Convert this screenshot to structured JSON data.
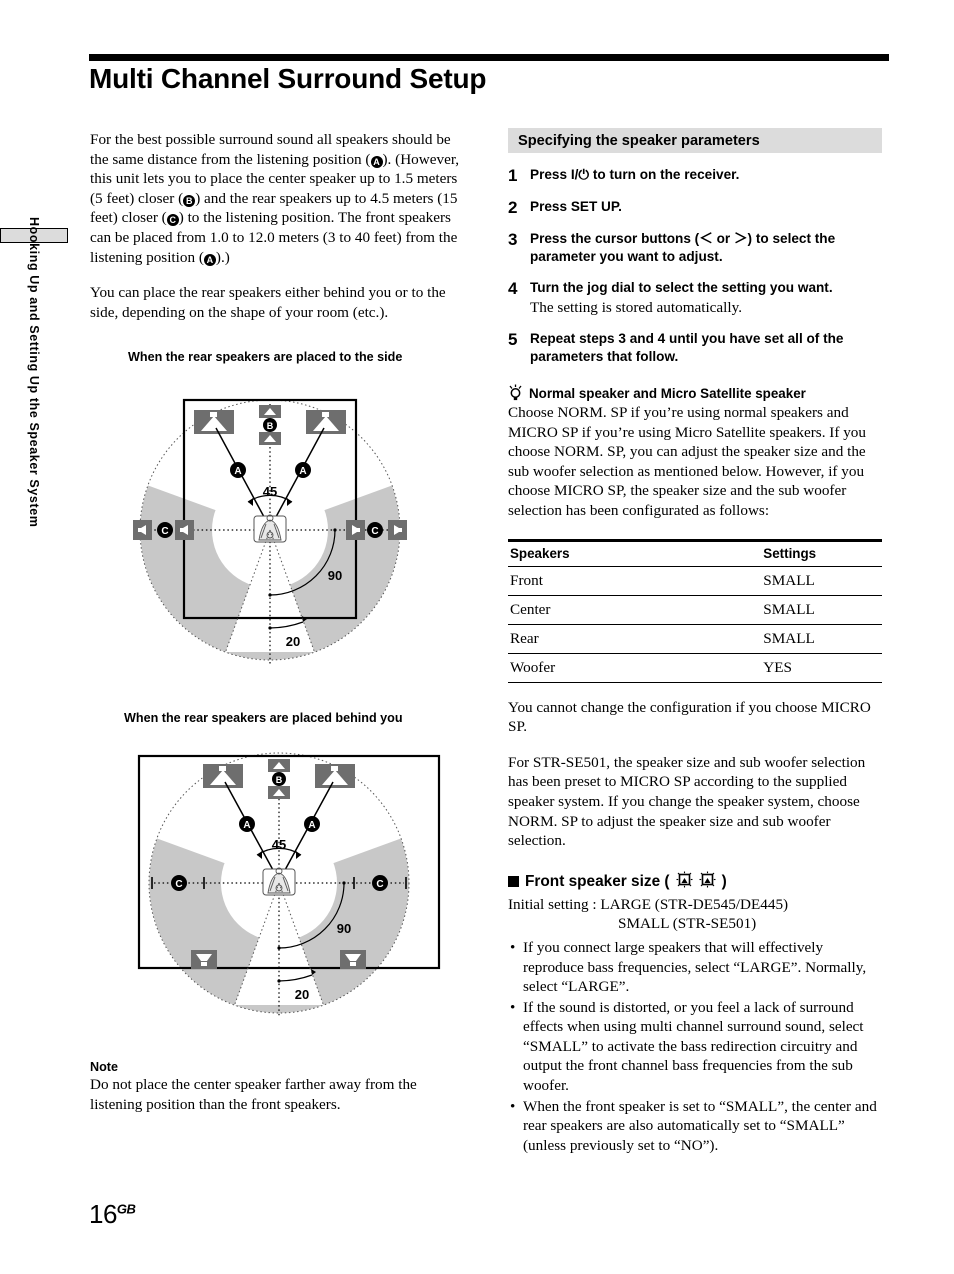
{
  "side_tab": {
    "label": "Hooking Up and Setting Up the Speaker System"
  },
  "title": "Multi Channel Surround Setup",
  "page_number": {
    "num": "16",
    "suffix": "GB"
  },
  "left": {
    "para1_a": "For the best possible surround sound all speakers should be the same distance from the listening position (",
    "mark_a1": "A",
    "para1_b": ").  (However, this unit lets you to place the center speaker up to 1.5 meters (5 feet) closer (",
    "mark_b": "B",
    "para1_c": ") and the rear speakers up to 4.5 meters (15 feet) closer (",
    "mark_c": "C",
    "para1_d": ") to the listening position. The front speakers can be placed from 1.0 to 12.0 meters (3 to 40 feet) from the listening position (",
    "mark_a2": "A",
    "para1_e": ").)",
    "para2": "You can place the rear speakers either behind you or to the side, depending on the shape of your room (etc.).",
    "diagram1_caption": "When the rear speakers are placed to the side",
    "diagram2_caption": "When the rear speakers are placed behind you",
    "note_head": "Note",
    "note_body": "Do not place the center speaker farther away from the listening position than the front speakers."
  },
  "diagram": {
    "angle_45": "45",
    "angle_90": "90",
    "angle_20": "20",
    "label_a": "A",
    "label_b": "B",
    "label_c": "C",
    "shade_color": "#c8c8c8",
    "speaker_color": "#6e6e6e"
  },
  "right": {
    "section_heading": "Specifying the speaker parameters",
    "steps": [
      {
        "num": "1",
        "main": "Press I/⏻ to turn on the receiver.",
        "sub": ""
      },
      {
        "num": "2",
        "main": "Press SET UP.",
        "sub": ""
      },
      {
        "num": "3",
        "main": "Press the cursor buttons (＜ or ＞) to select the parameter you want to adjust.",
        "sub": ""
      },
      {
        "num": "4",
        "main": "Turn the jog dial to select the setting you want.",
        "sub": "The setting is stored automatically."
      },
      {
        "num": "5",
        "main": "Repeat steps 3 and 4 until you have set all of the parameters that follow.",
        "sub": ""
      }
    ],
    "tip": {
      "title": "Normal speaker and Micro Satellite speaker",
      "body": "Choose NORM. SP if you’re using normal speakers and MICRO SP if you’re using Micro Satellite speakers. If you choose NORM. SP, you can adjust the speaker size and the sub woofer selection as mentioned below. However, if you choose MICRO SP, the speaker size and the sub woofer selection has been configurated as follows:"
    },
    "table": {
      "headers": [
        "Speakers",
        "Settings"
      ],
      "rows": [
        [
          "Front",
          "SMALL"
        ],
        [
          "Center",
          "SMALL"
        ],
        [
          "Rear",
          "SMALL"
        ],
        [
          "Woofer",
          "YES"
        ]
      ]
    },
    "after_table": "You cannot change the configuration if you choose MICRO SP.",
    "se501_para": "For STR-SE501, the speaker size and sub woofer selection has been preset to MICRO SP according to the supplied speaker system. If you change the speaker system, choose NORM. SP to adjust the speaker size and sub woofer selection.",
    "front_size_head": "Front speaker size (",
    "front_size_head_end": ")",
    "initial_line1": "Initial setting : LARGE (STR-DE545/DE445)",
    "initial_line2": "SMALL (STR-SE501)",
    "bullets": [
      "If you connect large speakers that will effectively reproduce bass frequencies, select “LARGE”. Normally, select “LARGE”.",
      "If the sound is distorted, or you feel a lack of surround effects when using multi channel surround sound, select “SMALL” to activate the bass redirection circuitry and output the front channel bass frequencies from the sub woofer.",
      "When the front speaker is set to “SMALL”, the center and rear speakers are also automatically set to “SMALL” (unless previously set to “NO”)."
    ]
  }
}
